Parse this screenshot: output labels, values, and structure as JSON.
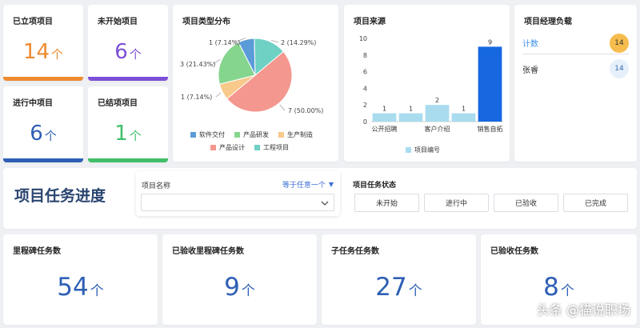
{
  "kpis": [
    {
      "title": "已立项项目",
      "value": "14",
      "unit": "个",
      "color": "#ee8a2f"
    },
    {
      "title": "未开始项目",
      "value": "6",
      "unit": "个",
      "color": "#7b4fd6"
    },
    {
      "title": "进行中项目",
      "value": "6",
      "unit": "个",
      "color": "#2e5fb5"
    },
    {
      "title": "已结项项目",
      "value": "1",
      "unit": "个",
      "color": "#3fbf6a"
    }
  ],
  "pie": {
    "title": "项目类型分布",
    "labels": [
      "1 (7.14%)",
      "2 (14.29%)",
      "7 (50.00%)",
      "1 (7.14%)",
      "3 (21.43%)"
    ],
    "legend": [
      "软件交付",
      "产品研发",
      "生产制造",
      "产品设计",
      "工程项目"
    ]
  },
  "bar": {
    "title": "项目来源",
    "legend": "项目编号"
  },
  "pm": {
    "title": "项目经理负载",
    "rows": [
      {
        "name": "计数",
        "value": "14"
      },
      {
        "name": "张睿",
        "value": "14"
      }
    ]
  },
  "section_title": "项目任务进度",
  "filter": {
    "label": "项目名称",
    "operator": "等于任意一个"
  },
  "status": {
    "label": "项目任务状态",
    "buttons": [
      "未开始",
      "进行中",
      "已验收",
      "已完成"
    ]
  },
  "task_kpis": [
    {
      "title": "里程碑任务数",
      "value": "54",
      "unit": "个"
    },
    {
      "title": "已验收里程碑任务数",
      "value": "9",
      "unit": "个"
    },
    {
      "title": "子任务任务数",
      "value": "27",
      "unit": "个"
    },
    {
      "title": "已验收任务数",
      "value": "8",
      "unit": "个"
    }
  ],
  "watermark": "头条 @猫说职场",
  "chart_data": [
    {
      "type": "pie",
      "title": "项目类型分布",
      "slices": [
        {
          "name": "软件交付",
          "value": 1,
          "percent": 7.14,
          "color": "#5b9bd8"
        },
        {
          "name": "工程项目",
          "value": 2,
          "percent": 14.29,
          "color": "#6fd0c4"
        },
        {
          "name": "产品设计",
          "value": 7,
          "percent": 50.0,
          "color": "#f4978e"
        },
        {
          "name": "生产制造",
          "value": 1,
          "percent": 7.14,
          "color": "#f7c98b"
        },
        {
          "name": "产品研发",
          "value": 3,
          "percent": 21.43,
          "color": "#86d58f"
        }
      ],
      "legend_position": "bottom"
    },
    {
      "type": "bar",
      "title": "项目来源",
      "categories": [
        "公开招聘",
        "",
        "客户介绍",
        "",
        "销售自拓"
      ],
      "values": [
        1,
        1,
        2,
        1,
        9
      ],
      "colors": [
        "#a9dcef",
        "#a9dcef",
        "#a9dcef",
        "#a9dcef",
        "#1667e0"
      ],
      "ylim": [
        0,
        10
      ],
      "yticks": [
        "0",
        "2",
        "4",
        "6",
        "8",
        "10"
      ],
      "series": [
        {
          "name": "项目编号",
          "values": [
            1,
            1,
            2,
            1,
            9
          ]
        }
      ],
      "legend_position": "bottom"
    }
  ]
}
